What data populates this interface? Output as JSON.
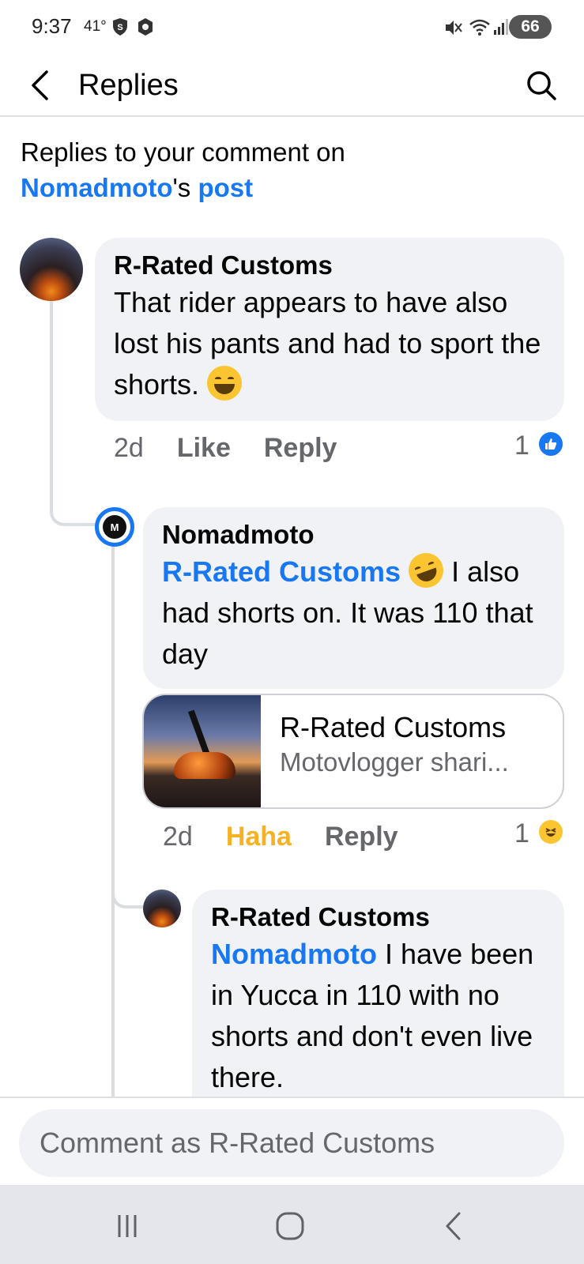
{
  "status_bar": {
    "time": "9:37",
    "temperature": "41°",
    "battery": "66"
  },
  "header": {
    "title": "Replies",
    "back_icon": "chevron-left-icon",
    "search_icon": "search-icon"
  },
  "intro": {
    "prefix": "Replies to your comment on",
    "page_name": "Nomadmoto",
    "possessive": "'s",
    "post_link": "post"
  },
  "comments": [
    {
      "author": "R-Rated Customs",
      "text": "That rider appears to have also lost his pants and had to sport the shorts.",
      "emoji": "grinning-face",
      "time": "2d",
      "like_label": "Like",
      "reply_label": "Reply",
      "reaction_count": "1",
      "reaction_type": "like"
    },
    {
      "author": "Nomadmoto",
      "mention": "R-Rated Customs",
      "emoji": "rolling-laughing-face",
      "text": "I also had shorts on. It was 110 that day",
      "time": "2d",
      "like_label": "Haha",
      "reply_label": "Reply",
      "reaction_count": "1",
      "reaction_type": "haha",
      "preview": {
        "title": "R-Rated Customs",
        "subtitle": "Motovlogger shari..."
      }
    },
    {
      "author": "R-Rated Customs",
      "mention": "Nomadmoto",
      "text": "I have been in Yucca in 110 with no shorts and don't even live there."
    }
  ],
  "composer": {
    "placeholder": "Comment as R-Rated Customs"
  },
  "colors": {
    "link": "#1877f2",
    "haha": "#f7b125",
    "bubble": "#f0f2f5"
  }
}
